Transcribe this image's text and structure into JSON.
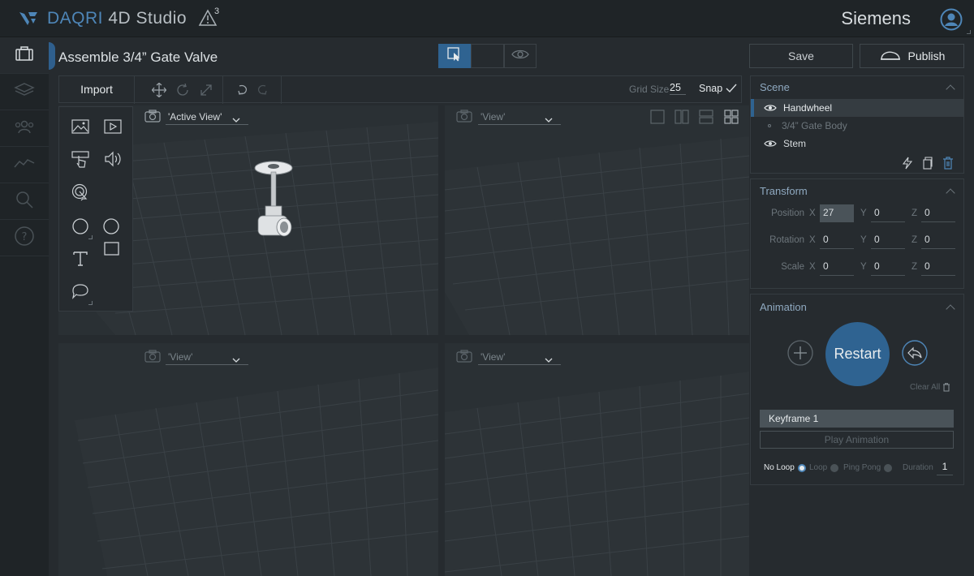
{
  "app": {
    "brand": "DAQRI",
    "product": "4D Studio",
    "alerts_count": "3",
    "user": "Siemens"
  },
  "document": {
    "title": "Assemble 3/4” Gate Valve"
  },
  "actions": {
    "save": "Save",
    "publish": "Publish"
  },
  "toolbar": {
    "import": "Import",
    "grid_size_label": "Grid Size",
    "grid_size_value": "25",
    "snap_label": "Snap"
  },
  "viewports": [
    {
      "camera": "'Active View'"
    },
    {
      "camera": "'View'"
    },
    {
      "camera": "'View'"
    },
    {
      "camera": "'View'"
    }
  ],
  "scene": {
    "title": "Scene",
    "items": [
      {
        "label": "Handwheel",
        "visible": true,
        "selected": true
      },
      {
        "label": "3/4” Gate Body",
        "visible": false,
        "selected": false
      },
      {
        "label": "Stem",
        "visible": true,
        "selected": false
      }
    ]
  },
  "transform": {
    "title": "Transform",
    "rows": [
      {
        "label": "Position",
        "x": "27",
        "y": "0",
        "z": "0"
      },
      {
        "label": "Rotation",
        "x": "0",
        "y": "0",
        "z": "0"
      },
      {
        "label": "Scale",
        "x": "0",
        "y": "0",
        "z": "0"
      }
    ],
    "axes": [
      "X",
      "Y",
      "Z"
    ]
  },
  "animation": {
    "title": "Animation",
    "restart": "Restart",
    "clear_all": "Clear All",
    "keyframe": "Keyframe 1",
    "play": "Play Animation",
    "loop_options": [
      "No Loop",
      "Loop",
      "Ping Pong"
    ],
    "loop_selected": "No Loop",
    "duration_label": "Duration",
    "duration_value": "1"
  },
  "colors": {
    "accent": "#2f6391",
    "background": "#262b2f",
    "topbar": "#1f2427"
  }
}
